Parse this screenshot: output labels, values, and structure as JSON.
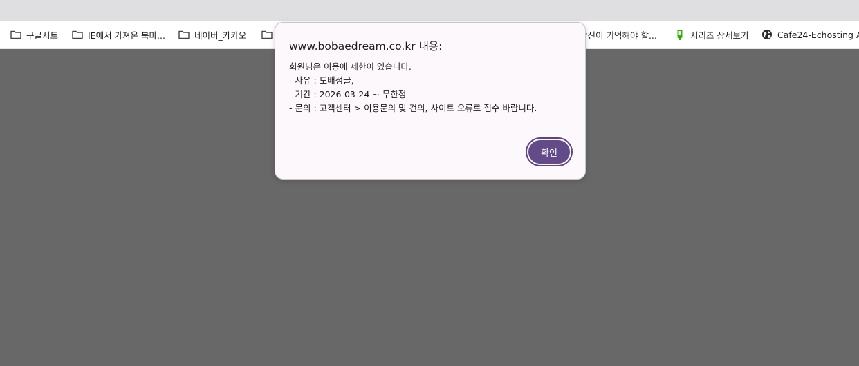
{
  "bookmarks": [
    {
      "label": "구글시트",
      "icon": "folder-icon"
    },
    {
      "label": "IE에서 가져온 북마...",
      "icon": "folder-icon"
    },
    {
      "label": "네이버_카카오",
      "icon": "folder-icon"
    },
    {
      "label": "",
      "icon": "folder-icon"
    },
    {
      "label": "당신이 기억해야 할...",
      "icon": ""
    },
    {
      "label": "시리즈 상세보기",
      "icon": "series-icon"
    },
    {
      "label": "Cafe24-Echosting A...",
      "icon": "globe-icon"
    }
  ],
  "dialog": {
    "title": "www.bobaedream.co.kr 내용:",
    "lines": [
      "회원님은 이용에 제한이 있습니다.",
      "- 사유 : 도배성글,",
      "- 기간 : 2026-03-24 ~ 무한정",
      "- 문의 : 고객센터 > 이용문의 및 건의, 사이트 오류로 접수 바랍니다."
    ],
    "ok_label": "확인"
  },
  "colors": {
    "page_overlay": "#686868",
    "dialog_bg": "#fdf8fc",
    "button_bg": "#624b88",
    "series_icon": "#2db400"
  }
}
